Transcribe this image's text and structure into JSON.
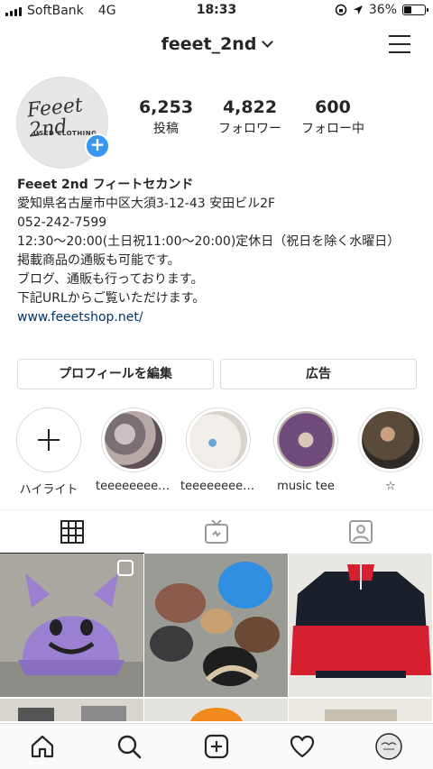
{
  "status_bar": {
    "carrier": "SoftBank",
    "network": "4G",
    "time": "18:33",
    "battery": "36%",
    "battery_level": 0.36
  },
  "header": {
    "username": "feeet_2nd"
  },
  "avatar_logo": {
    "line1": "Feeet 2nd",
    "line2": "USED CLOTHING"
  },
  "stats": [
    {
      "value": "6,253",
      "label": "投稿"
    },
    {
      "value": "4,822",
      "label": "フォロワー"
    },
    {
      "value": "600",
      "label": "フォロー中"
    }
  ],
  "bio": {
    "name": "Feeet 2nd フィートセカンド",
    "lines": [
      "愛知県名古屋市中区大須3-12-43 安田ビル2F",
      "052-242-7599",
      "12:30〜20:00(土日祝11:00〜20:00)定休日（祝日を除く水曜日）",
      "掲載商品の通販も可能です。",
      "ブログ、通販も行っております。",
      "下記URLからご覧いただけます。"
    ],
    "link": "www.feeetshop.net/"
  },
  "buttons": {
    "edit_profile": "プロフィールを編集",
    "ads": "広告"
  },
  "highlights": [
    {
      "label": "ハイライト",
      "icon": "plus-icon"
    },
    {
      "label": "teeeeeeeee...",
      "color": "#9a8f92"
    },
    {
      "label": "teeeeeeeee...",
      "color": "#e8e4e0"
    },
    {
      "label": "music tee",
      "color": "#6e4b7a"
    },
    {
      "label": "☆",
      "color": "#5a4a3a"
    }
  ],
  "tabs": [
    {
      "name": "grid",
      "icon": "grid-icon"
    },
    {
      "name": "igtv",
      "icon": "igtv-icon"
    },
    {
      "name": "tagged",
      "icon": "tagged-person-icon"
    }
  ],
  "posts": [
    {
      "subject": "purple devil cap",
      "color": "#9b7fd1"
    },
    {
      "subject": "winter caps",
      "color": "#8a8c86"
    },
    {
      "subject": "fleece jacket",
      "color": "#1a1f2c"
    }
  ],
  "nav": [
    {
      "icon": "home-icon"
    },
    {
      "icon": "search-icon"
    },
    {
      "icon": "add-post-icon"
    },
    {
      "icon": "heart-icon"
    },
    {
      "icon": "profile-avatar-icon"
    }
  ],
  "colors": {
    "accent_blue": "#3897f0",
    "link": "#003569",
    "border": "#dbdbdb",
    "red_fleece": "#d7202f"
  }
}
